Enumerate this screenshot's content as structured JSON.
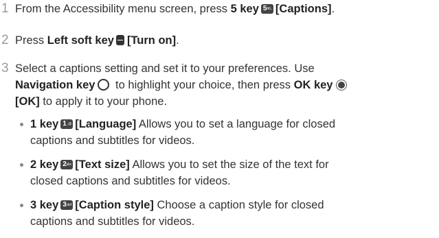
{
  "steps": [
    {
      "number": "1",
      "line1_pre": "From the Accessibility menu screen, press ",
      "line1_key": "5 key",
      "line1_icon": "5",
      "line1_icon_letters": "JKL",
      "line1_target": "[Captions]",
      "line1_end": "."
    },
    {
      "number": "2",
      "line1_pre": "Press ",
      "line1_key": "Left soft key",
      "line1_target": "[Turn on]",
      "line1_end": "."
    },
    {
      "number": "3",
      "line1": "Select a captions setting and set it to your preferences. Use",
      "line2_key": "Navigation key",
      "line2_mid": " to highlight your choice, then press ",
      "line2_key2": "OK key",
      "line3_target": "[OK]",
      "line3_rest": " to apply it to your phone."
    }
  ],
  "subitems": [
    {
      "key": "1 key",
      "icon": "1",
      "icon_letters": ".@",
      "target": "[Language]",
      "text1": " Allows you to set a language for closed",
      "text2": "captions and subtitles for videos."
    },
    {
      "key": "2 key",
      "icon": "2",
      "icon_letters": "abc",
      "target": "[Text size]",
      "text1": " Allows you to set the size of the text for",
      "text2": "closed captions and subtitles for videos."
    },
    {
      "key": "3 key",
      "icon": "3",
      "icon_letters": "def",
      "target": "[Caption style]",
      "text1": " Choose a caption style for closed",
      "text2": "captions and subtitles for videos."
    }
  ]
}
